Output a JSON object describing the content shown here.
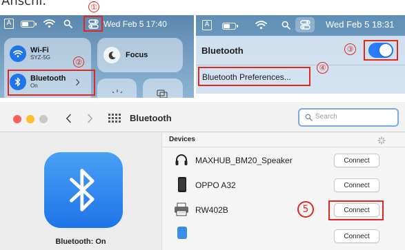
{
  "caption": {
    "top": "Anschl."
  },
  "step_numbers": [
    "①",
    "②",
    "③",
    "④",
    "5"
  ],
  "panel_a": {
    "menubar": {
      "input_letter": "A",
      "datetime": "Wed Feb 5  17:40"
    },
    "wifi": {
      "title": "Wi-Fi",
      "subtitle": "SYZ-5G"
    },
    "focus": {
      "title": "Focus"
    },
    "bluetooth": {
      "title": "Bluetooth",
      "subtitle": "On"
    }
  },
  "panel_b": {
    "menubar": {
      "input_letter": "A",
      "datetime": "Wed Feb 5  18:31"
    },
    "bluetooth_label": "Bluetooth",
    "preferences_label": "Bluetooth Preferences...",
    "toggle_on": true
  },
  "window": {
    "title": "Bluetooth",
    "search_placeholder": "Search",
    "status": "Bluetooth: On",
    "devices_header": "Devices",
    "devices": [
      {
        "name": "MAXHUB_BM20_Speaker",
        "icon": "headphones-icon",
        "action": "Connect"
      },
      {
        "name": "OPPO A32",
        "icon": "phone-icon",
        "action": "Connect"
      },
      {
        "name": "RW402B",
        "icon": "printer-icon",
        "action": "Connect"
      },
      {
        "name": "",
        "icon": "device-icon",
        "action": "Connect"
      }
    ]
  },
  "colors": {
    "accent": "#2a7bf6",
    "annotation": "#e0261d",
    "bluetooth_tile": "#1e74e8"
  }
}
